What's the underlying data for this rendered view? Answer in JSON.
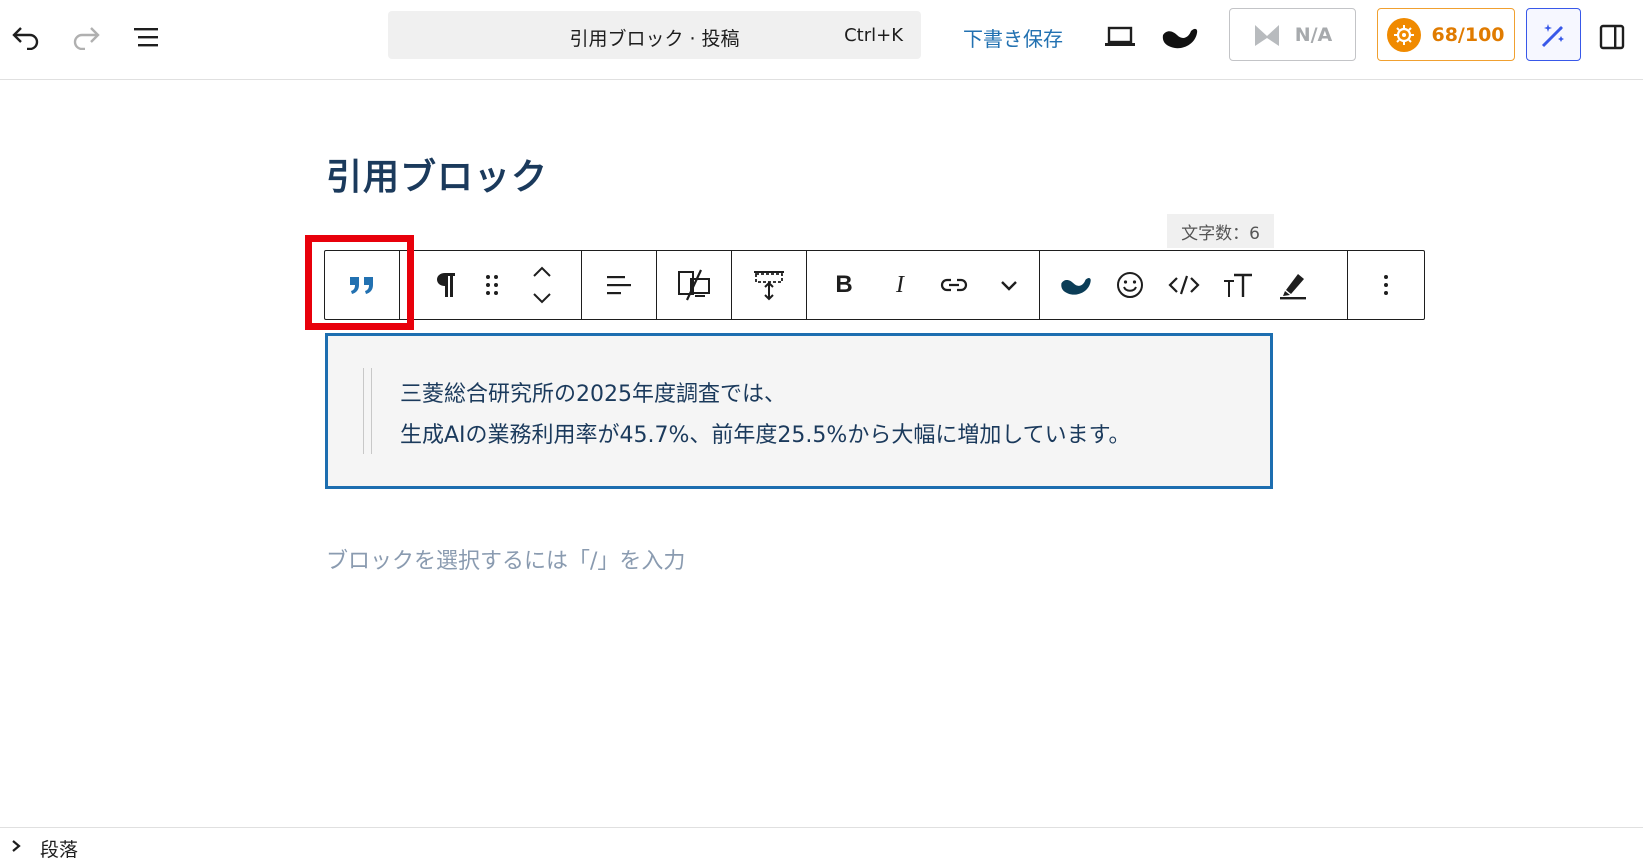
{
  "header": {
    "command_title": "引用ブロック · 投稿",
    "command_shortcut": "Ctrl+K",
    "save_draft_label": "下書き保存",
    "na_label": "N/A",
    "score_label": "68/100"
  },
  "editor": {
    "post_title": "引用ブロック",
    "char_count": "文字数：6",
    "quote_lines": [
      "三菱総合研究所の2025年度調査では、",
      "生成AIの業務利用率が45.7%、前年度25.5%から大幅に増加しています。"
    ],
    "placeholder": "ブロックを選択するには「/」を入力"
  },
  "footer": {
    "breadcrumb": "段落"
  },
  "icons": {
    "undo": "undo-icon",
    "redo": "redo-icon",
    "outline": "list-view-icon",
    "block_type": "quote-icon"
  },
  "colors": {
    "accent": "#2271b1",
    "highlight": "#e8000b",
    "title": "#1b3a5c",
    "score": "#e07b00"
  }
}
